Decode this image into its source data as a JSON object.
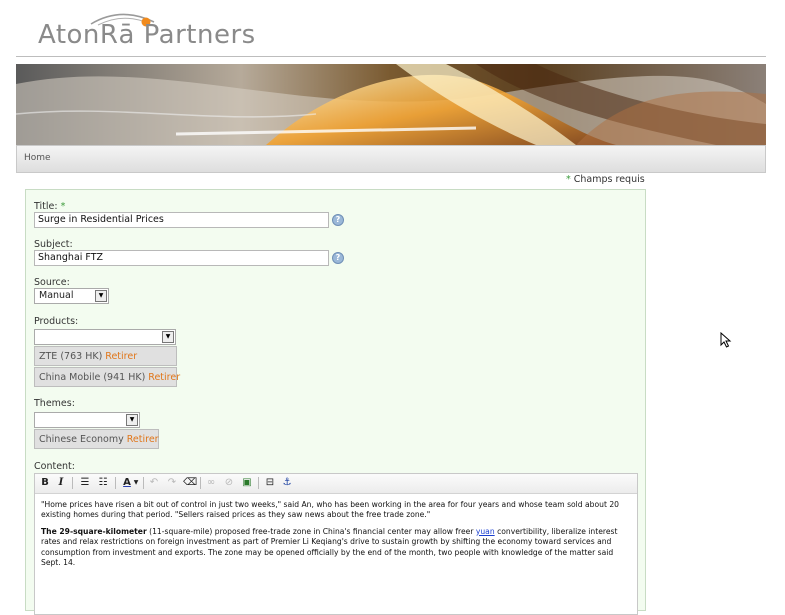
{
  "header": {
    "logo_text": "AtonRā Partners"
  },
  "nav": {
    "home_label": "Home"
  },
  "required_note": {
    "star": "*",
    "label": "Champs requis"
  },
  "form": {
    "title_label": "Title:",
    "title_star": "*",
    "title_value": "Surge in Residential Prices",
    "subject_label": "Subject:",
    "subject_value": "Shanghai FTZ",
    "help_icon": "?",
    "source_label": "Source:",
    "source_value": "Manual",
    "products_label": "Products:",
    "products": [
      {
        "name": "ZTE (763 HK)",
        "remove": "Retirer"
      },
      {
        "name": "China Mobile (941 HK)",
        "remove": "Retirer"
      }
    ],
    "themes_label": "Themes:",
    "themes": [
      {
        "name": "Chinese Economy",
        "remove": "Retirer"
      }
    ],
    "content_label": "Content:"
  },
  "editor": {
    "toolbar": {
      "bold": "B",
      "italic": "I",
      "font_color": "A"
    },
    "paragraph1": "\"Home prices have risen a bit out of control in just two weeks,\" said An, who has been working in the area for four years and whose team sold about 20 existing homes during that period. \"Sellers raised prices as they saw news about the free trade zone.\"",
    "p2_bold": "The 29-square-kilometer",
    "p2_part1": " (11-square-mile) proposed free-trade zone in China's financial center may allow freer ",
    "p2_link": "yuan",
    "p2_part2": " convertibility, liberalize interest rates and relax restrictions on foreign investment as part of Premier Li Keqiang's drive to sustain growth by shifting the economy toward services and consumption from investment and exports. The zone may be opened officially by the end of the month, two people with knowledge of the matter said Sept. 14."
  },
  "colors": {
    "form_bg": "#f3fcf0",
    "remove_link": "#e0761a",
    "required_star": "#3a9a3a"
  }
}
